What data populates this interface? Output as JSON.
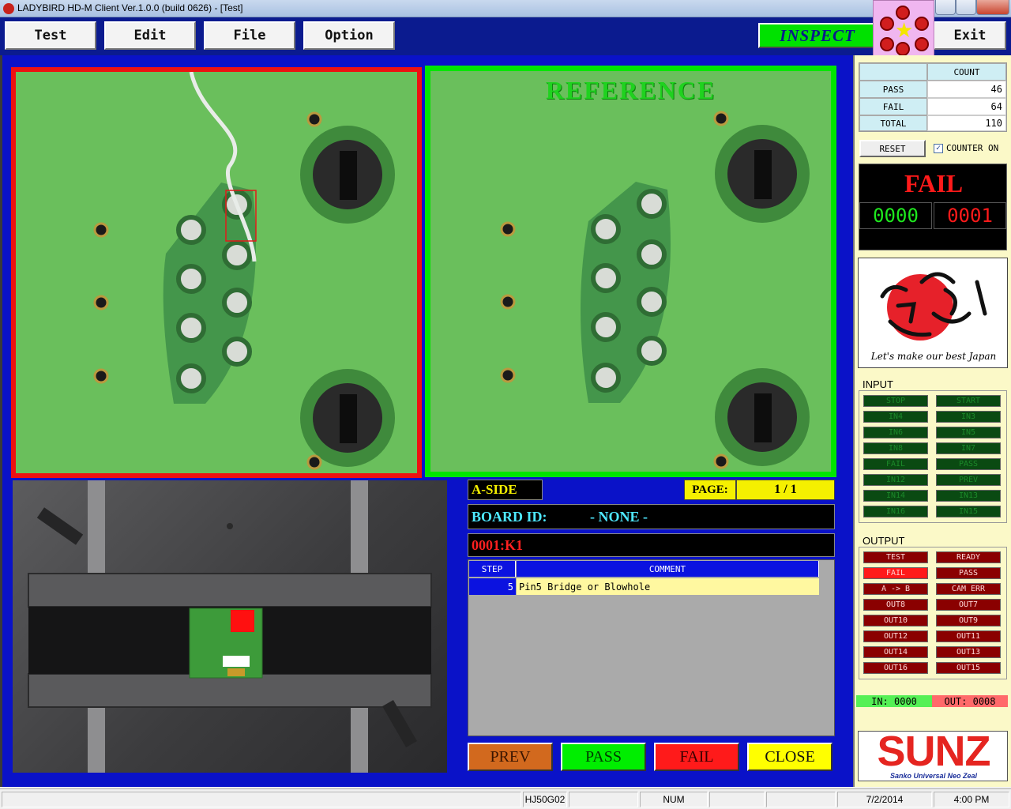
{
  "window": {
    "title": "LADYBIRD HD-M Client Ver.1.0.0  (build 0626) - [Test]"
  },
  "menu": {
    "test": "Test",
    "edit": "Edit",
    "file": "File",
    "option": "Option",
    "inspect": "INSPECT",
    "exit": "Exit"
  },
  "images": {
    "reference_title": "REFERENCE"
  },
  "info": {
    "side": "A-SIDE",
    "page_label": "PAGE:",
    "page_value": "1 / 1",
    "board_id_label": "BOARD ID:",
    "board_id_value": "- NONE -",
    "part_id": "0001:K1"
  },
  "steps": {
    "headers": {
      "step": "STEP",
      "comment": "COMMENT"
    },
    "rows": [
      {
        "step": "5",
        "comment": "Pin5 Bridge or Blowhole"
      }
    ]
  },
  "actions": {
    "prev": "PREV",
    "pass": "PASS",
    "fail": "FAIL",
    "close": "CLOSE"
  },
  "counter": {
    "header": "COUNT",
    "rows": [
      {
        "label": "PASS",
        "value": "46"
      },
      {
        "label": "FAIL",
        "value": "64"
      },
      {
        "label": "TOTAL",
        "value": "110"
      }
    ],
    "reset": "RESET",
    "counter_on_label": "COUNTER ON",
    "counter_on_checked": true
  },
  "result": {
    "text": "FAIL",
    "left_digits": "0000",
    "right_digits": "0001"
  },
  "logo": {
    "caption": "Let's make our best Japan"
  },
  "input": {
    "title": "INPUT",
    "items": [
      "STOP",
      "START",
      "IN4",
      "IN3",
      "IN6",
      "IN5",
      "IN8",
      "IN7",
      "FAIL",
      "PASS",
      "IN12",
      "PREV",
      "IN14",
      "IN13",
      "IN16",
      "IN15"
    ]
  },
  "output": {
    "title": "OUTPUT",
    "items": [
      {
        "label": "TEST",
        "on": false
      },
      {
        "label": "READY",
        "on": false
      },
      {
        "label": "FAIL",
        "on": true
      },
      {
        "label": "PASS",
        "on": false
      },
      {
        "label": "A -> B",
        "on": false
      },
      {
        "label": "CAM ERR",
        "on": false
      },
      {
        "label": "OUT8",
        "on": false
      },
      {
        "label": "OUT7",
        "on": false
      },
      {
        "label": "OUT10",
        "on": false
      },
      {
        "label": "OUT9",
        "on": false
      },
      {
        "label": "OUT12",
        "on": false
      },
      {
        "label": "OUT11",
        "on": false
      },
      {
        "label": "OUT14",
        "on": false
      },
      {
        "label": "OUT13",
        "on": false
      },
      {
        "label": "OUT16",
        "on": false
      },
      {
        "label": "OUT15",
        "on": false
      }
    ]
  },
  "io_status": {
    "in": "IN: 0000",
    "out": "OUT: 0008"
  },
  "brand": {
    "name": "SUNZ",
    "tagline": "Sanko Universal Neo Zeal"
  },
  "statusbar": {
    "model": "HJ50G02",
    "num": "NUM",
    "date": "7/2/2014",
    "time": "4:00 PM"
  },
  "colors": {
    "main_blue": "#0a12c8",
    "fail_red": "#ee1111",
    "pass_green": "#00e500",
    "pcb_green": "#6abf5c"
  }
}
